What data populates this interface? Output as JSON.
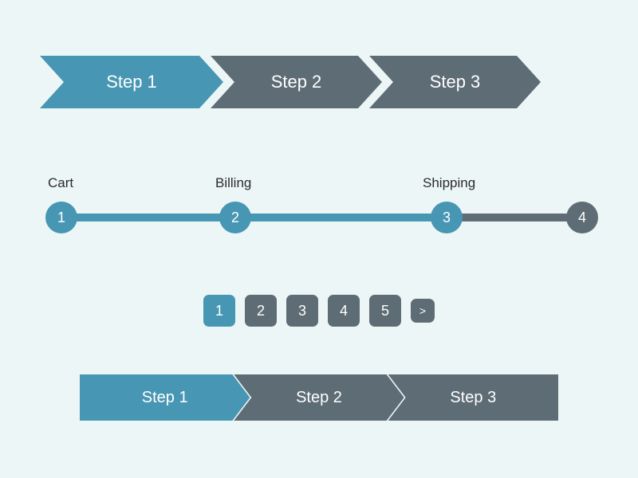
{
  "colors": {
    "active": "#4796b3",
    "inactive": "#5e6c75",
    "bg": "#edf6f6"
  },
  "chevron_stepper": {
    "steps": [
      {
        "label": "Step 1",
        "active": true
      },
      {
        "label": "Step 2",
        "active": false
      },
      {
        "label": "Step 3",
        "active": false
      }
    ]
  },
  "dot_stepper": {
    "nodes": [
      {
        "number": "1",
        "label": "Cart",
        "done": true
      },
      {
        "number": "2",
        "label": "Billing",
        "done": true
      },
      {
        "number": "3",
        "label": "Shipping",
        "done": true
      },
      {
        "number": "4",
        "label": "",
        "done": false
      }
    ]
  },
  "pagination": {
    "pages": [
      {
        "label": "1",
        "active": true
      },
      {
        "label": "2",
        "active": false
      },
      {
        "label": "3",
        "active": false
      },
      {
        "label": "4",
        "active": false
      },
      {
        "label": "5",
        "active": false
      }
    ],
    "next_label": ">"
  },
  "bar_stepper": {
    "steps": [
      {
        "label": "Step 1",
        "active": true
      },
      {
        "label": "Step 2",
        "active": false
      },
      {
        "label": "Step 3",
        "active": false
      }
    ]
  }
}
